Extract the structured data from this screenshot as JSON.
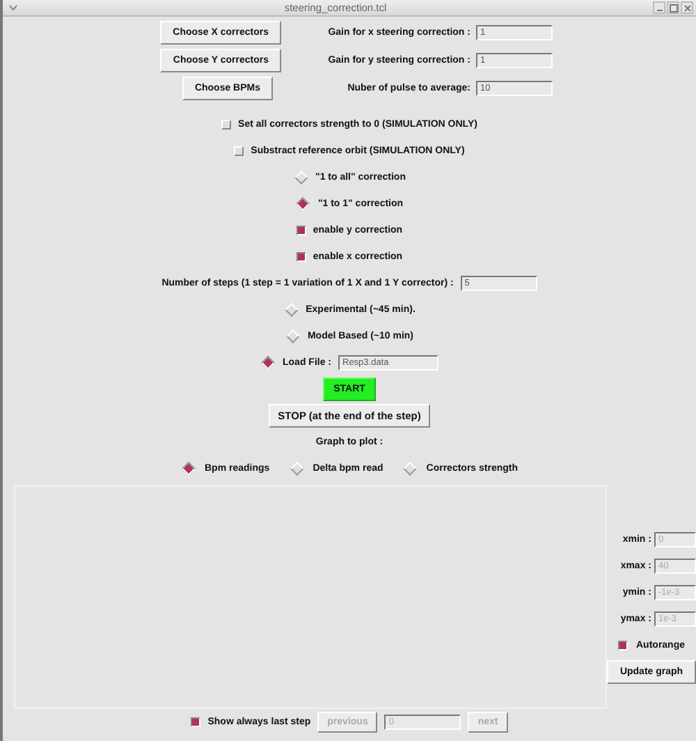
{
  "window": {
    "title": "steering_correction.tcl"
  },
  "settings": [
    {
      "button": "Choose X correctors",
      "label": "Gain for x steering correction :",
      "value": "1"
    },
    {
      "button": "Choose Y correctors",
      "label": "Gain for y steering correction :",
      "value": "1"
    },
    {
      "button": "Choose BPMs",
      "label": "Nuber of pulse to average:",
      "value": "10"
    }
  ],
  "options": [
    {
      "kind": "checkbox",
      "label": "Set all correctors strength to 0 (SIMULATION ONLY)",
      "checked": false
    },
    {
      "kind": "checkbox",
      "label": "Substract reference orbit (SIMULATION ONLY)",
      "checked": false
    },
    {
      "kind": "radio",
      "label": "\"1 to all\" correction",
      "selected": false
    },
    {
      "kind": "radio",
      "label": "\"1 to 1\" correction",
      "selected": true
    },
    {
      "kind": "checkbox",
      "label": "enable y correction",
      "checked": true
    },
    {
      "kind": "checkbox",
      "label": "enable x correction",
      "checked": true
    }
  ],
  "steps": {
    "label": "Number of steps (1 step = 1 variation of 1 X and 1 Y corrector) :",
    "value": "5"
  },
  "methods": [
    {
      "label": "Experimental (~45 min).",
      "selected": false
    },
    {
      "label": "Model Based (~10 min)",
      "selected": false
    },
    {
      "label": "Load File :",
      "selected": true,
      "value": "Resp3.data"
    }
  ],
  "start": "START",
  "stop": "STOP (at the end of the step)",
  "graph_choice": {
    "label": "Graph to plot :",
    "options": [
      {
        "label": "Bpm readings",
        "selected": true
      },
      {
        "label": "Delta bpm read",
        "selected": false
      },
      {
        "label": "Correctors strength",
        "selected": false
      }
    ]
  },
  "axes": [
    {
      "label": "xmin :",
      "value": "0",
      "disabled": true
    },
    {
      "label": "xmax :",
      "value": "40",
      "disabled": true
    },
    {
      "label": "ymin :",
      "value": "-1e-3",
      "disabled": true
    },
    {
      "label": "ymax :",
      "value": "1e-3",
      "disabled": true
    }
  ],
  "autorange": {
    "label": "Autorange",
    "checked": true
  },
  "update": "Update graph",
  "footer": {
    "show_last": {
      "label": "Show always last step",
      "checked": true
    },
    "previous": {
      "label": "previous",
      "disabled": true
    },
    "step": {
      "value": "0",
      "disabled": true
    },
    "next": {
      "label": "next",
      "disabled": true
    }
  }
}
